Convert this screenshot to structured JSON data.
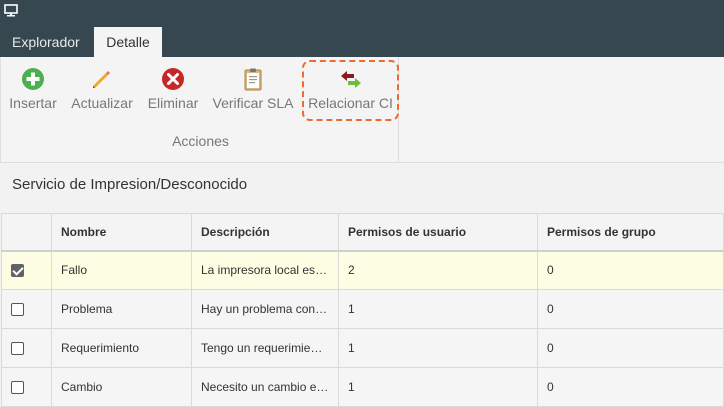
{
  "tabs": [
    {
      "label": "Explorador",
      "active": false
    },
    {
      "label": "Detalle",
      "active": true
    }
  ],
  "ribbon": {
    "buttons": [
      {
        "label": "Insertar",
        "icon": "plus-circle-icon",
        "color": "#4caf50"
      },
      {
        "label": "Actualizar",
        "icon": "pencil-icon",
        "color": "#f0a030"
      },
      {
        "label": "Eliminar",
        "icon": "delete-circle-icon",
        "color": "#c62828"
      },
      {
        "label": "Verificar SLA",
        "icon": "clipboard-icon",
        "color": "#c8a96b"
      },
      {
        "label": "Relacionar CI",
        "icon": "swap-arrows-icon",
        "color": "#8b1a1a"
      }
    ],
    "group_label": "Acciones"
  },
  "section_title": "Servicio de Impresion/Desconocido",
  "grid": {
    "columns": [
      "Nombre",
      "Descripción",
      "Permisos de usuario",
      "Permisos de grupo"
    ],
    "rows": [
      {
        "checked": true,
        "nombre": "Fallo",
        "descripcion": "La impresora local est…",
        "permisos_usuario": "2",
        "permisos_grupo": "0"
      },
      {
        "checked": false,
        "nombre": "Problema",
        "descripcion": "Hay un problema con …",
        "permisos_usuario": "1",
        "permisos_grupo": "0"
      },
      {
        "checked": false,
        "nombre": "Requerimiento",
        "descripcion": "Tengo un requerimien…",
        "permisos_usuario": "1",
        "permisos_grupo": "0"
      },
      {
        "checked": false,
        "nombre": "Cambio",
        "descripcion": "Necesito un cambio e…",
        "permisos_usuario": "1",
        "permisos_grupo": "0"
      }
    ]
  },
  "colors": {
    "header_bg": "#37474f",
    "focus_outline": "#f06a2e",
    "selected_row": "#fdfde3"
  }
}
